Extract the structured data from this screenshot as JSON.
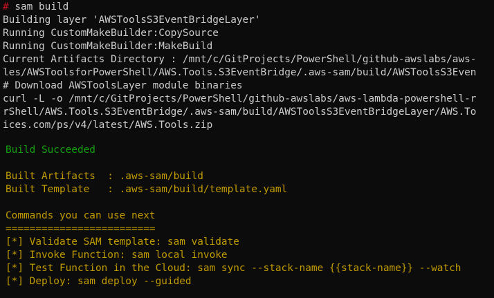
{
  "terminal": {
    "prompt_symbol": "#",
    "command": " sam build",
    "output_lines": [
      "Building layer 'AWSToolsS3EventBridgeLayer'",
      "Running CustomMakeBuilder:CopySource",
      "Running CustomMakeBuilder:MakeBuild",
      "Current Artifacts Directory : /mnt/c/GitProjects/PowerShell/github-awslabs/aws-",
      "les/AWSToolsforPowerShell/AWS.Tools.S3EventBridge/.aws-sam/build/AWSToolsS3Even",
      "# Download AWSToolsLayer module binaries",
      "curl -L -o /mnt/c/GitProjects/PowerShell/github-awslabs/aws-lambda-powershell-r",
      "rShell/AWS.Tools.S3EventBridge/.aws-sam/build/AWSToolsS3EventBridgeLayer/AWS.To",
      "ices.com/ps/v4/latest/AWS.Tools.zip"
    ],
    "build_status": "Build Succeeded",
    "built_artifacts": "Built Artifacts  : .aws-sam/build",
    "built_template": "Built Template   : .aws-sam/build/template.yaml",
    "commands_heading": "Commands you can use next",
    "separator": "=========================",
    "commands": [
      "[*] Validate SAM template: sam validate",
      "[*] Invoke Function: sam local invoke",
      "[*] Test Function in the Cloud: sam sync --stack-name {{stack-name}} --watch",
      "[*] Deploy: sam deploy --guided"
    ],
    "colors": {
      "background": "#0c0c0c",
      "text": "#cccccc",
      "prompt": "#c50f1f",
      "success": "#13a10e",
      "info": "#c19c00"
    }
  }
}
